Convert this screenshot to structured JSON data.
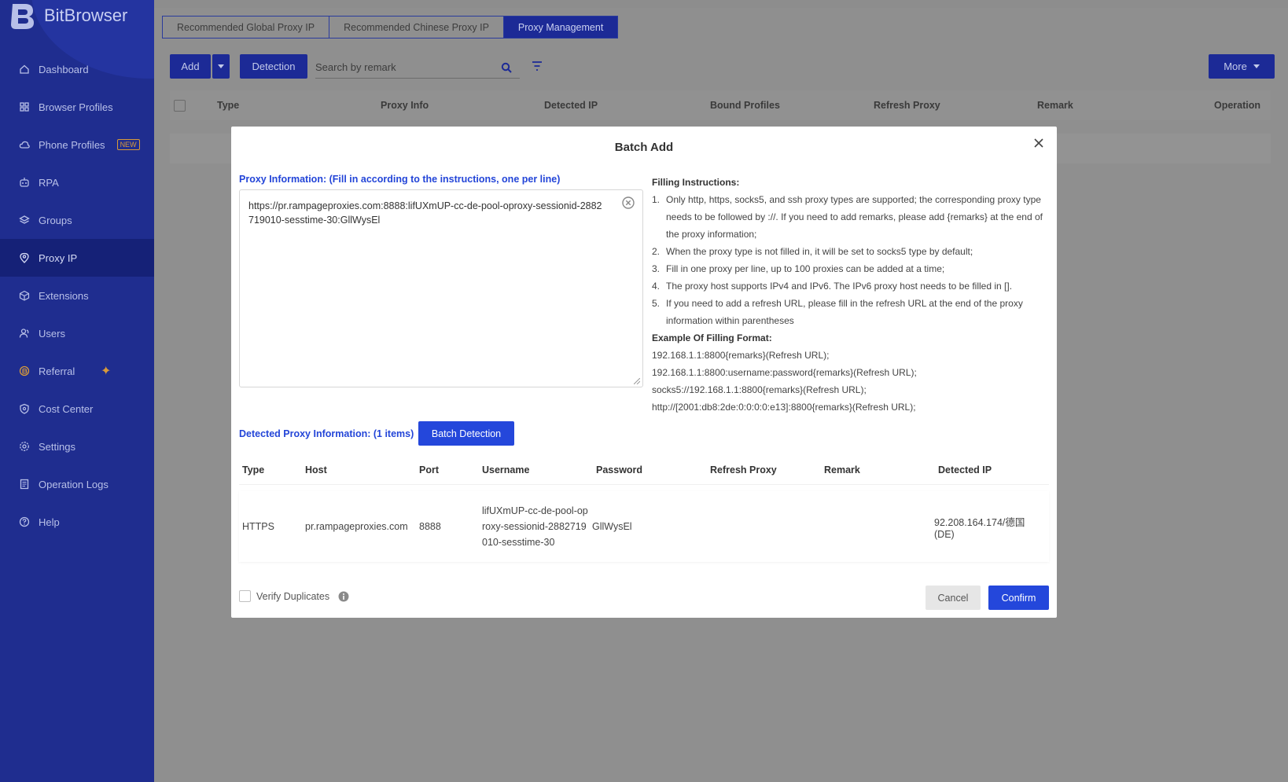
{
  "app": {
    "name": "BitBrowser"
  },
  "sidebar": {
    "items": [
      {
        "label": "Dashboard",
        "icon": "home-icon"
      },
      {
        "label": "Browser Profiles",
        "icon": "grid-icon"
      },
      {
        "label": "Phone Profiles",
        "icon": "cloud-icon",
        "badge": "NEW"
      },
      {
        "label": "RPA",
        "icon": "robot-icon"
      },
      {
        "label": "Groups",
        "icon": "layers-icon"
      },
      {
        "label": "Proxy IP",
        "icon": "location-icon",
        "active": true
      },
      {
        "label": "Extensions",
        "icon": "cube-icon"
      },
      {
        "label": "Users",
        "icon": "users-icon"
      },
      {
        "label": "Referral",
        "icon": "coin-icon"
      },
      {
        "label": "Cost Center",
        "icon": "shield-icon"
      },
      {
        "label": "Settings",
        "icon": "gear-icon"
      },
      {
        "label": "Operation Logs",
        "icon": "log-icon"
      },
      {
        "label": "Help",
        "icon": "help-icon"
      }
    ]
  },
  "tabs": [
    {
      "label": "Recommended Global Proxy IP"
    },
    {
      "label": "Recommended Chinese Proxy IP"
    },
    {
      "label": "Proxy Management",
      "active": true
    }
  ],
  "toolbar": {
    "add_label": "Add",
    "detection_label": "Detection",
    "search_placeholder": "Search by remark",
    "more_label": "More"
  },
  "table": {
    "columns": [
      "Type",
      "Proxy Info",
      "Detected IP",
      "Bound Profiles",
      "Refresh Proxy",
      "Remark",
      "Operation"
    ]
  },
  "modal": {
    "title": "Batch Add",
    "proxy_info_label": "Proxy Information: (Fill in according to the instructions, one per line)",
    "proxy_text": "https://pr.rampageproxies.com:8888:lifUXmUP-cc-de-pool-oproxy-sessionid-2882719010-sesstime-30:GllWysEl",
    "instructions_title": "Filling Instructions:",
    "instructions": [
      "Only http, https, socks5, and ssh proxy types are supported; the corresponding proxy type needs to be followed by ://. If you need to add remarks, please add {remarks} at the end of the proxy information;",
      "When the proxy type is not filled in, it will be set to socks5 type by default;",
      "Fill in one proxy per line, up to 100 proxies can be added at a time;",
      "The proxy host supports IPv4 and IPv6. The IPv6 proxy host needs to be filled in [].",
      "If you need to add a refresh URL, please fill in the refresh URL at the end of the proxy information within parentheses"
    ],
    "example_title": "Example Of Filling Format:",
    "examples": [
      "192.168.1.1:8800{remarks}(Refresh URL);",
      "192.168.1.1:8800:username:password{remarks}(Refresh URL);",
      "socks5://192.168.1.1:8800{remarks}(Refresh URL);",
      "http://[2001:db8:2de:0:0:0:0:e13]:8800{remarks}(Refresh URL);"
    ],
    "detected_label": "Detected Proxy Information: (1 items)",
    "batch_detection_label": "Batch Detection",
    "detected_columns": [
      "Type",
      "Host",
      "Port",
      "Username",
      "Password",
      "Refresh Proxy",
      "Remark",
      "Detected IP"
    ],
    "detected_rows": [
      {
        "type": "HTTPS",
        "host": "pr.rampageproxies.com",
        "port": "8888",
        "username": "lifUXmUP-cc-de-pool-oproxy-sessionid-2882719010-sesstime-30",
        "password": "GllWysEl",
        "refresh": "",
        "remark": "",
        "detected_ip": "92.208.164.174/德国(DE)"
      }
    ],
    "verify_duplicates_label": "Verify Duplicates",
    "cancel_label": "Cancel",
    "confirm_label": "Confirm"
  }
}
